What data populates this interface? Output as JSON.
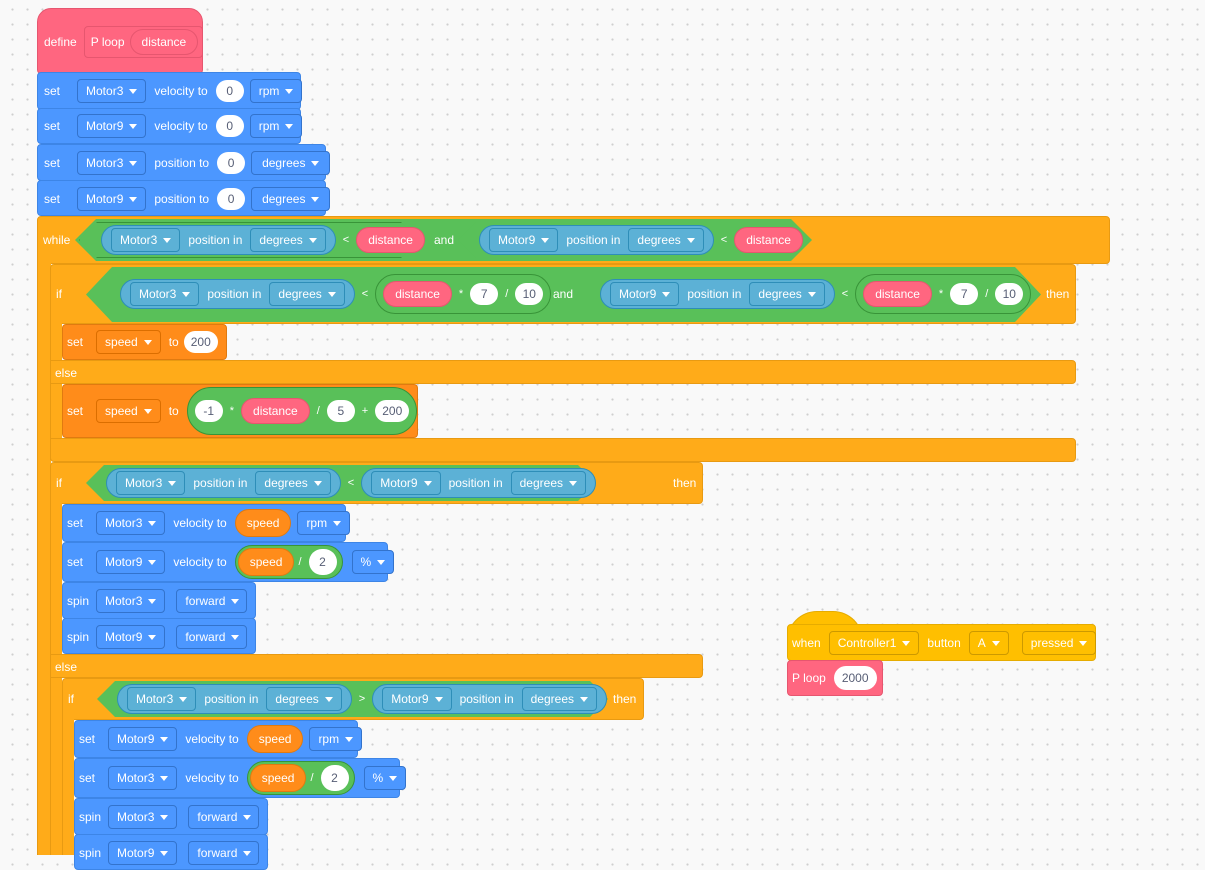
{
  "workspace": {
    "background": "#f9f9f9"
  },
  "colors": {
    "my_blocks": "#ff6680",
    "motion": "#4c97ff",
    "control": "#ffab19",
    "variables": "#ff8c1a",
    "operators": "#59c059",
    "sensing": "#5cb1d6",
    "events": "#ffbf00"
  },
  "define_block": {
    "keyword": "define",
    "proc_name": "P loop",
    "param": "distance"
  },
  "init_blocks": [
    {
      "verb": "set",
      "motor": "Motor3",
      "action": "velocity to",
      "value": "0",
      "unit": "rpm"
    },
    {
      "verb": "set",
      "motor": "Motor9",
      "action": "velocity to",
      "value": "0",
      "unit": "rpm"
    },
    {
      "verb": "set",
      "motor": "Motor3",
      "action": "position to",
      "value": "0",
      "unit": "degrees"
    },
    {
      "verb": "set",
      "motor": "Motor9",
      "action": "position to",
      "value": "0",
      "unit": "degrees"
    }
  ],
  "while_block": {
    "keyword": "while",
    "left": {
      "motor": "Motor3",
      "label": "position in",
      "unit": "degrees",
      "op": "<",
      "var": "distance"
    },
    "join": "and",
    "right": {
      "motor": "Motor9",
      "label": "position in",
      "unit": "degrees",
      "op": "<",
      "var": "distance"
    }
  },
  "if1": {
    "keyword": "if",
    "then": "then",
    "else": "else",
    "left": {
      "motor": "Motor3",
      "label": "position in",
      "unit": "degrees",
      "op": "<",
      "var": "distance",
      "mul": "*",
      "a": "7",
      "div": "/",
      "b": "10"
    },
    "join": "and",
    "right": {
      "motor": "Motor9",
      "label": "position in",
      "unit": "degrees",
      "op": "<",
      "var": "distance",
      "mul": "*",
      "a": "7",
      "div": "/",
      "b": "10"
    },
    "then_block": {
      "verb": "set",
      "var": "speed",
      "to": "to",
      "value": "200"
    },
    "else_block": {
      "verb": "set",
      "var": "speed",
      "to": "to",
      "n1": "-1",
      "op1": "*",
      "dvar": "distance",
      "op2": "/",
      "n2": "5",
      "op3": "+",
      "n3": "200"
    }
  },
  "if2": {
    "keyword": "if",
    "then": "then",
    "else": "else",
    "cond": {
      "m1": "Motor3",
      "label": "position in",
      "u1": "degrees",
      "op": "<",
      "m2": "Motor9",
      "u2": "degrees"
    },
    "body": [
      {
        "verb": "set",
        "motor": "Motor3",
        "action": "velocity to",
        "var": "speed",
        "unit": "rpm"
      },
      {
        "verb": "set",
        "motor": "Motor9",
        "action": "velocity to",
        "var": "speed",
        "op": "/",
        "value": "2",
        "unit": "%"
      },
      {
        "verb": "spin",
        "motor": "Motor3",
        "dir": "forward"
      },
      {
        "verb": "spin",
        "motor": "Motor9",
        "dir": "forward"
      }
    ]
  },
  "if3": {
    "keyword": "if",
    "then": "then",
    "cond": {
      "m1": "Motor3",
      "label": "position in",
      "u1": "degrees",
      "op": ">",
      "m2": "Motor9",
      "u2": "degrees"
    },
    "body": [
      {
        "verb": "set",
        "motor": "Motor9",
        "action": "velocity to",
        "var": "speed",
        "unit": "rpm"
      },
      {
        "verb": "set",
        "motor": "Motor3",
        "action": "velocity to",
        "var": "speed",
        "op": "/",
        "value": "2",
        "unit": "%"
      },
      {
        "verb": "spin",
        "motor": "Motor3",
        "dir": "forward"
      },
      {
        "verb": "spin",
        "motor": "Motor9",
        "dir": "forward"
      }
    ]
  },
  "event_block": {
    "keyword": "when",
    "controller": "Controller1",
    "label": "button",
    "button": "A",
    "state": "pressed"
  },
  "call_block": {
    "proc_name": "P loop",
    "arg": "2000"
  }
}
